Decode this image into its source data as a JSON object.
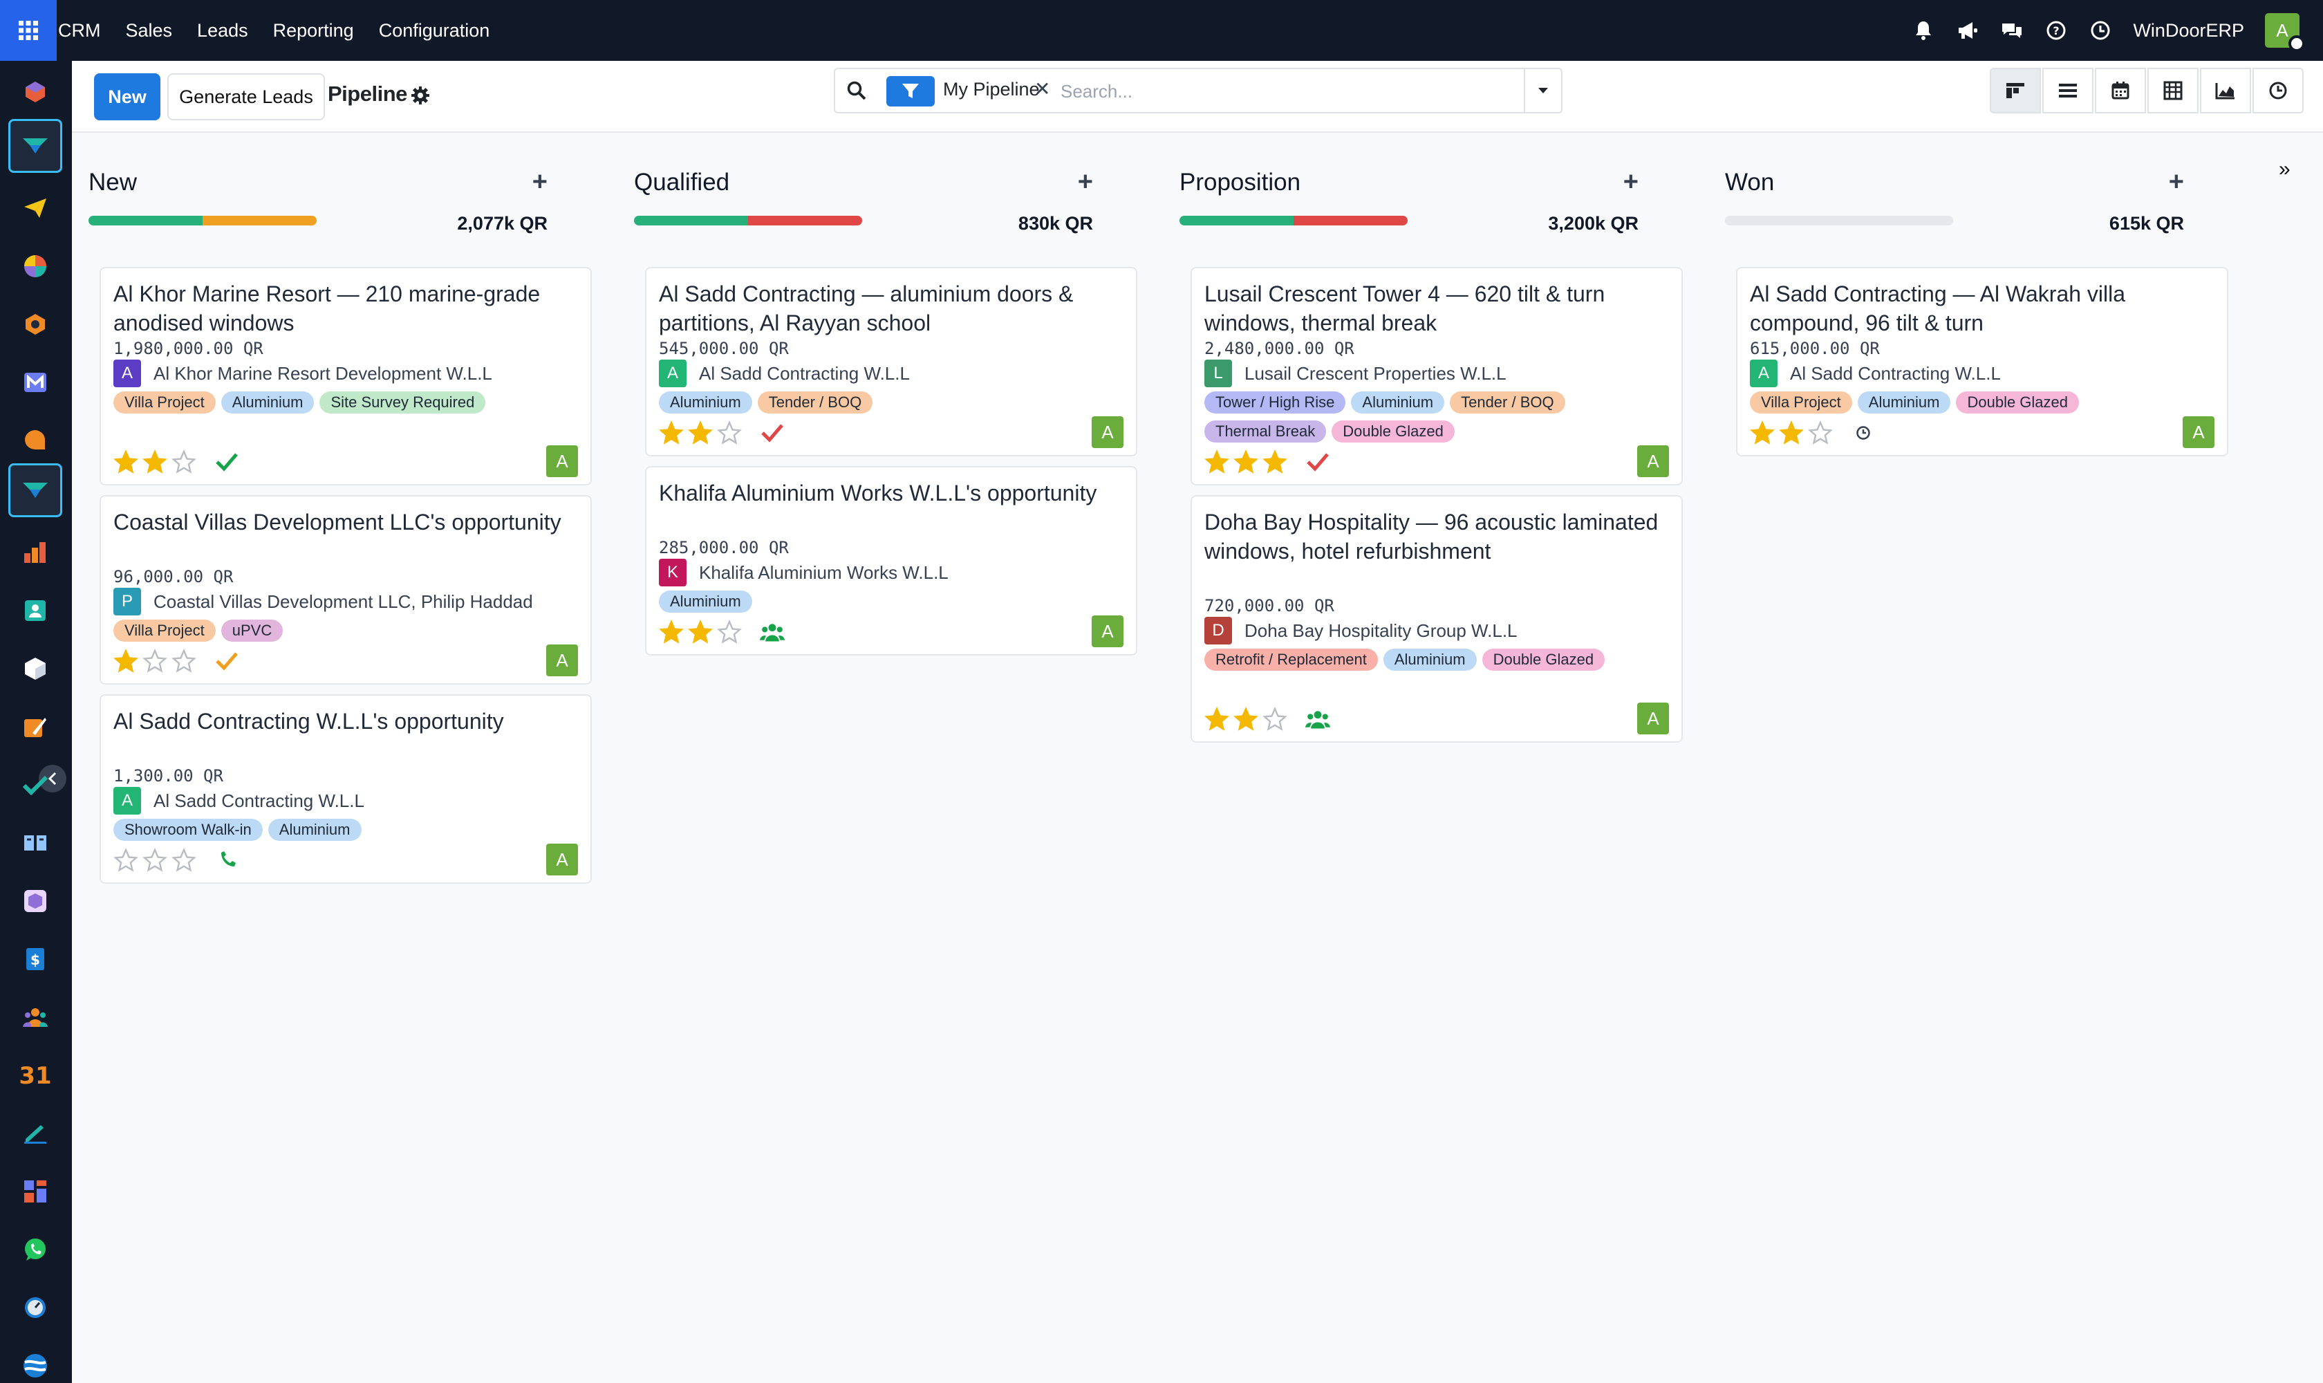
{
  "topbar": {
    "menu": [
      "CRM",
      "Sales",
      "Leads",
      "Reporting",
      "Configuration"
    ],
    "company": "WinDoorERP",
    "user_initial": "A",
    "icons": [
      "bell-icon",
      "megaphone-icon",
      "chat-icon",
      "help-icon",
      "clock-icon"
    ]
  },
  "sidebar": {
    "apps": [
      "discuss",
      "crm",
      "email-marketing",
      "dashboards",
      "project",
      "mail",
      "live-chat",
      "crm-active",
      "sales-reports",
      "contacts",
      "inventory",
      "studio",
      "todo",
      "knowledge",
      "3d-product",
      "accounting",
      "employees",
      "calendar",
      "sign",
      "dashboard-grid",
      "whatsapp",
      "timer",
      "portal"
    ],
    "active": [
      "crm",
      "crm-active"
    ]
  },
  "control": {
    "new_label": "New",
    "generate_label": "Generate Leads",
    "view_title": "Pipeline",
    "facet": "My Pipeline",
    "facet_remove": "✕",
    "search_placeholder": "Search...",
    "views": [
      "kanban-view-icon",
      "list-view-icon",
      "calendar-view-icon",
      "pivot-view-icon",
      "graph-view-icon",
      "activity-view-icon"
    ]
  },
  "columns": [
    {
      "name": "New",
      "total": "2,077k QR",
      "bar": [
        {
          "color": "#28b07a",
          "fraction": 0.5
        },
        {
          "color": "#f0a020",
          "fraction": 0.5
        }
      ],
      "cards": [
        {
          "title": "Al Khor Marine Resort — 210 marine-grade anodised windows",
          "amount": "1,980,000.00 QR",
          "partner_initial": "A",
          "partner_color": "#5b3cc4",
          "partner": "Al Khor Marine Resort Development W.L.L",
          "tags": [
            {
              "label": "Villa Project",
              "color": "#f8c9a3"
            },
            {
              "label": "Aluminium",
              "color": "#bcdaf5"
            },
            {
              "label": "Site Survey Required",
              "color": "#bfe9c8"
            }
          ],
          "stars": 2,
          "activity": "check-icon",
          "activity_color": "#16a34a",
          "assignee": "A"
        },
        {
          "title": "Coastal Villas Development LLC's opportunity",
          "amount": "96,000.00 QR",
          "partner_initial": "P",
          "partner_color": "#2a9bb5",
          "partner": "Coastal Villas Development LLC, Philip Haddad",
          "tags": [
            {
              "label": "Villa Project",
              "color": "#f8c9a3"
            },
            {
              "label": "uPVC",
              "color": "#e2b6dc"
            }
          ],
          "stars": 1,
          "activity": "check-icon",
          "activity_color": "#f0a020",
          "assignee": "A"
        },
        {
          "title": "Al Sadd Contracting W.L.L's opportunity",
          "amount": "1,300.00 QR",
          "partner_initial": "A",
          "partner_color": "#22b573",
          "partner": "Al Sadd Contracting W.L.L",
          "tags": [
            {
              "label": "Showroom Walk-in",
              "color": "#bcdaf5"
            },
            {
              "label": "Aluminium",
              "color": "#bcdaf5"
            }
          ],
          "stars": 0,
          "activity": "phone-icon",
          "activity_color": "#16a34a",
          "assignee": "A"
        }
      ]
    },
    {
      "name": "Qualified",
      "total": "830k QR",
      "bar": [
        {
          "color": "#28b07a",
          "fraction": 0.5
        },
        {
          "color": "#e04848",
          "fraction": 0.5
        }
      ],
      "cards": [
        {
          "title": "Al Sadd Contracting — aluminium doors & partitions, Al Rayyan school",
          "amount": "545,000.00 QR",
          "partner_initial": "A",
          "partner_color": "#22b573",
          "partner": "Al Sadd Contracting W.L.L",
          "tags": [
            {
              "label": "Aluminium",
              "color": "#bcdaf5"
            },
            {
              "label": "Tender / BOQ",
              "color": "#f8c9a3"
            }
          ],
          "stars": 2,
          "activity": "check-icon",
          "activity_color": "#e04848",
          "assignee": "A"
        },
        {
          "title": "Khalifa Aluminium Works W.L.L's opportunity",
          "amount": "285,000.00 QR",
          "partner_initial": "K",
          "partner_color": "#c2185b",
          "partner": "Khalifa Aluminium Works W.L.L",
          "tags": [
            {
              "label": "Aluminium",
              "color": "#bcdaf5"
            }
          ],
          "stars": 2,
          "activity": "users-icon",
          "activity_color": "#16a34a",
          "assignee": "A"
        }
      ]
    },
    {
      "name": "Proposition",
      "total": "3,200k QR",
      "bar": [
        {
          "color": "#28b07a",
          "fraction": 0.5
        },
        {
          "color": "#e04848",
          "fraction": 0.5
        }
      ],
      "cards": [
        {
          "title": "Lusail Crescent Tower 4 — 620 tilt & turn windows, thermal break",
          "amount": "2,480,000.00 QR",
          "partner_initial": "L",
          "partner_color": "#3a9a6a",
          "partner": "Lusail Crescent Properties W.L.L",
          "tags": [
            {
              "label": "Tower / High Rise",
              "color": "#b4b8f5"
            },
            {
              "label": "Aluminium",
              "color": "#bcdaf5"
            },
            {
              "label": "Tender / BOQ",
              "color": "#f8c9a3"
            },
            {
              "label": "Thermal Break",
              "color": "#c8b6ea"
            },
            {
              "label": "Double Glazed",
              "color": "#f5b6d8"
            }
          ],
          "stars": 3,
          "activity": "check-icon",
          "activity_color": "#e04848",
          "assignee": "A"
        },
        {
          "title": "Doha Bay Hospitality — 96 acoustic laminated windows, hotel refurbishment",
          "amount": "720,000.00 QR",
          "partner_initial": "D",
          "partner_color": "#b5423a",
          "partner": "Doha Bay Hospitality Group W.L.L",
          "tags": [
            {
              "label": "Retrofit / Replacement",
              "color": "#f8b0a8"
            },
            {
              "label": "Aluminium",
              "color": "#bcdaf5"
            },
            {
              "label": "Double Glazed",
              "color": "#f5b6d8"
            }
          ],
          "stars": 2,
          "activity": "users-icon",
          "activity_color": "#16a34a",
          "assignee": "A"
        }
      ]
    },
    {
      "name": "Won",
      "total": "615k QR",
      "bar": [],
      "cards": [
        {
          "title": "Al Sadd Contracting — Al Wakrah villa compound, 96 tilt & turn",
          "amount": "615,000.00 QR",
          "partner_initial": "A",
          "partner_color": "#22b573",
          "partner": "Al Sadd Contracting W.L.L",
          "tags": [
            {
              "label": "Villa Project",
              "color": "#f8c9a3"
            },
            {
              "label": "Aluminium",
              "color": "#bcdaf5"
            },
            {
              "label": "Double Glazed",
              "color": "#f5b6d8"
            }
          ],
          "stars": 2,
          "activity": "clock-icon",
          "activity_color": "#374151",
          "assignee": "A"
        }
      ]
    }
  ],
  "fold_label": "»"
}
